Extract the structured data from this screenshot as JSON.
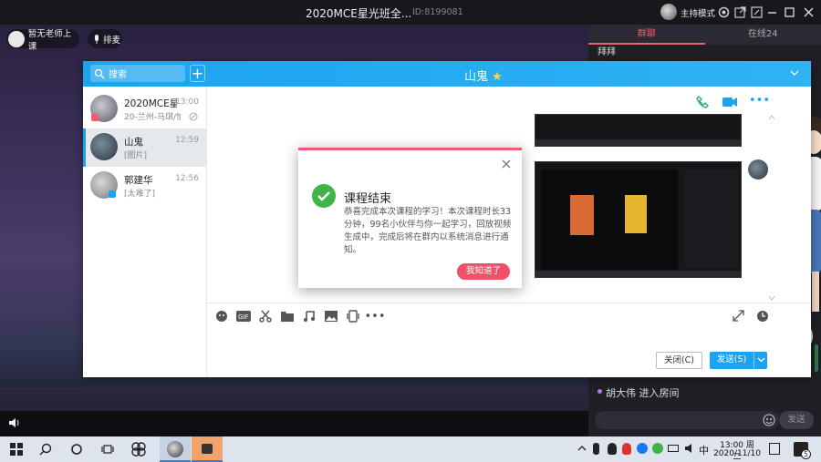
{
  "topbar": {
    "title": "2020MCE星光班全...",
    "room_id": "ID:8199081",
    "host_mode": "主持模式"
  },
  "stage": {
    "no_teacher": "暂无老师上课",
    "queue": "排麦"
  },
  "right_panel": {
    "tabs": [
      {
        "label": "群聊",
        "active": true
      },
      {
        "label": "在线24",
        "active": false
      }
    ],
    "top_message": "拜拜",
    "system_message": "胡大伟 进入房间",
    "send_label": "发送"
  },
  "chat_window": {
    "search_placeholder": "搜索",
    "title": "山鬼",
    "title_star": "★",
    "contacts": [
      {
        "name": "2020MCE星",
        "sub": "20-兰州-马琪/怕",
        "time": "13:00",
        "selected": false
      },
      {
        "name": "山鬼",
        "sub": "[图片]",
        "time": "12:59",
        "selected": true
      },
      {
        "name": "郭建华",
        "sub": "[太难了]",
        "time": "12:56",
        "selected": false
      }
    ],
    "close_button": "关闭(C)",
    "send_button": "发送(S)"
  },
  "dialog": {
    "title": "课程结束",
    "body": "恭喜完成本次课程的学习！本次课程时长33分钟，99名小伙伴与你一起学习，回放视频生成中，完成后将在群内以系统消息进行通知。",
    "confirm": "我知道了"
  },
  "taskbar": {
    "time": "13:00 周二",
    "date": "2020/11/10",
    "ime": "中",
    "notif_count": "5"
  },
  "colors": {
    "accent_blue": "#1ca3f0",
    "accent_red": "#f0506a"
  }
}
